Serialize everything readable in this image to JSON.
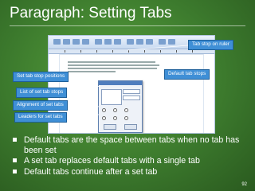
{
  "slide": {
    "title": "Paragraph: Setting Tabs",
    "number": "92",
    "colors": {
      "background": "#3d7a2e",
      "callout": "#3f8fd6",
      "text": "#ffffff"
    }
  },
  "callouts": {
    "tab_stop_on_ruler": "Tab stop on ruler",
    "default_tab_stops": "Default tab stops",
    "set_tab_stop_positions": "Set tab stop positions",
    "list_of_set_tab_stops": "List of set tab stops",
    "alignment_of_set_tabs": "Alignment of set tabs",
    "leaders_for_set_tabs": "Leaders for set tabs"
  },
  "bullets": [
    "Default tabs are the space between tabs when no tab has been set",
    "A set tab replaces default tabs with a single tab",
    "Default tabs continue after a set tab"
  ],
  "icons": {
    "bullet": "square-bullet-icon"
  }
}
